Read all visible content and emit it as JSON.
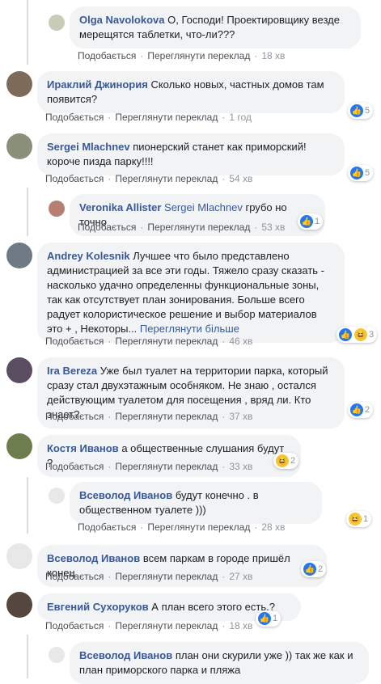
{
  "labels": {
    "like": "Подобається",
    "translate": "Переглянути переклад",
    "see_more": "Переглянути більше"
  },
  "comments": [
    {
      "author": "Olga Navolokova",
      "text": "О, Господи! Проектировщику везде мерещятся таблетки, что-ли???",
      "time": "18 хв"
    },
    {
      "author": "Ираклий Джинория",
      "text": "Сколько новых, частных домов там появится?",
      "time": "1 год",
      "reaction_count": "5"
    },
    {
      "author": "Sergei Mlachnev",
      "text": "пионерский станет как приморский! короче пизда парку!!!!",
      "time": "54 хв",
      "reaction_count": "5"
    },
    {
      "author": "Veronika Allister",
      "mention": "Sergei Mlachnev",
      "text": "грубо но точно",
      "time": "53 хв",
      "reaction_count": "1"
    },
    {
      "author": "Andrey Kolesnik",
      "text": "Лучшее что было представлено администрацией за все эти годы. Тяжело сразу сказать - насколько удачно определенны функциональные зоны, так как отсутствует план зонирования. Больше всего радует колористическое решение и выбор материалов это + , Некоторы...",
      "time": "46 хв",
      "reaction_count": "3"
    },
    {
      "author": "Ira Bereza",
      "text": "Уже был туалет на территории парка, который сразу стал двухэтажным особняком. Не знаю , остался действующим туалетом для посещения , вряд ли. Кто знает?",
      "time": "37 хв",
      "reaction_count": "2"
    },
    {
      "author": "Костя Иванов",
      "text": "а общественные слушания будут ?",
      "time": "33 хв",
      "reaction_count": "2"
    },
    {
      "author": "Всеволод Иванов",
      "text": "будут конечно . в общественном туалете )))",
      "time": "28 хв",
      "reaction_count": "1"
    },
    {
      "author": "Всеволод Иванов",
      "text": "всем паркам в городе пришёл конец",
      "time": "27 хв",
      "reaction_count": "2"
    },
    {
      "author": "Евгений Сухоруков",
      "text": "А план всего этого есть,?",
      "time": "18 хв",
      "reaction_count": "1"
    },
    {
      "author": "Всеволод Иванов",
      "text": "план они скурили уже )) так же как и план приморского парка и пляжа"
    }
  ],
  "colors": {
    "author": "#385898",
    "bubble": "#f2f3f5",
    "like": "#2078f4",
    "haha": "#f7c631"
  }
}
